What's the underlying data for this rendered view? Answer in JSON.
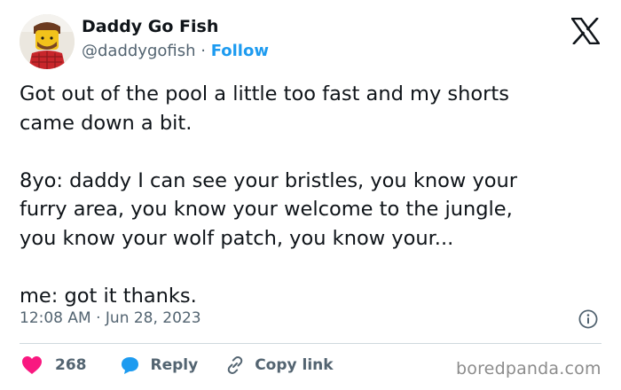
{
  "author": {
    "display_name": "Daddy Go Fish",
    "handle": "@daddygofish",
    "separator": " · ",
    "follow_label": "Follow"
  },
  "platform_icon": "x-logo-icon",
  "tweet": {
    "text": "Got out of the pool a little too fast and my shorts\ncame down a bit.\n\n8yo: daddy I can see your bristles, you know your\nfurry area, you know your welcome to the jungle,\nyou know your wolf patch, you know your...\n\nme: got it thanks.",
    "timestamp": "12:08 AM · Jun 28, 2023"
  },
  "actions": {
    "like_count": "268",
    "reply_label": "Reply",
    "copy_label": "Copy link"
  },
  "icons": {
    "info": "info-icon",
    "heart": "heart-icon",
    "reply": "reply-bubble-icon",
    "link": "link-icon"
  },
  "watermark": "boredpanda.com",
  "colors": {
    "text": "#0f1419",
    "secondary": "#536471",
    "accent": "#1d9bf0",
    "heart": "#f91880",
    "divider": "#cfd9de",
    "watermark": "#8c8c8c"
  }
}
